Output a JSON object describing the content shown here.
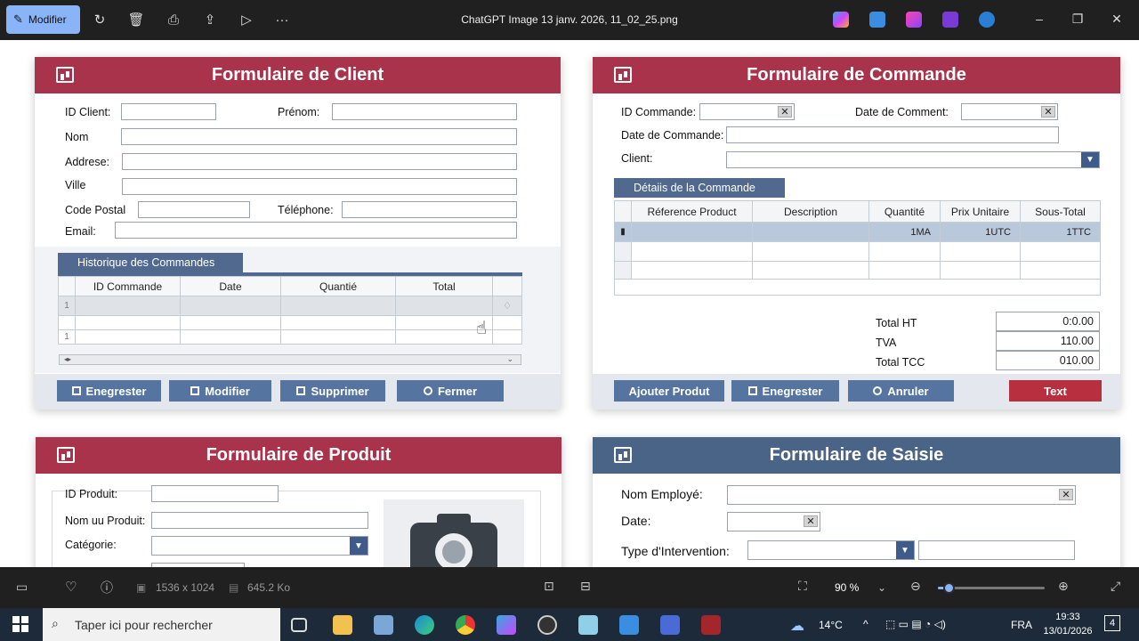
{
  "topbar": {
    "edit_label": "Modifier",
    "title": "ChatGPT Image 13 janv. 2026, 11_02_25.png"
  },
  "client_form": {
    "title": "Formulaire de Client",
    "labels": {
      "id": "ID Client:",
      "prenom": "Prénom:",
      "nom": "Nom",
      "adresse": "Addrese:",
      "ville": "Ville",
      "cp": "Code Postal",
      "tel": "Téléphone:",
      "email": "Email:"
    },
    "history_title": "Historique des Commandes",
    "history_cols": [
      "ID Commande",
      "Date",
      "Quantié",
      "Total"
    ],
    "row_num_1": "1",
    "row_num_3": "1",
    "buttons": [
      "Enegrester",
      "Modifier",
      "Supprimer",
      "Fermer"
    ]
  },
  "order_form": {
    "title": "Formulaire de Commande",
    "labels": {
      "id": "ID Commande:",
      "date_comment": "Date de Comment:",
      "date": "Date de Commande:",
      "client": "Client:"
    },
    "details_title": "Détaiis de la Commande",
    "cols": [
      "Réference Product",
      "Description",
      "Quantité",
      "Prix Unitaire",
      "Sous-Total"
    ],
    "row1": {
      "qty": "1MA",
      "unit": "1UTC",
      "sub": "1TTC"
    },
    "totals": [
      {
        "label": "Total HT",
        "value": "0:0.00"
      },
      {
        "label": "TVA",
        "value": "110.00"
      },
      {
        "label": "Total TCC",
        "value": "010.00"
      }
    ],
    "buttons": [
      "Ajouter Produt",
      "Enegrester",
      "Anruler",
      "Text"
    ]
  },
  "product_form": {
    "title": "Formulaire de Produit",
    "labels": {
      "id": "ID Produit:",
      "nom": "Nom uu Produit:",
      "cat": "Catégorie:"
    }
  },
  "entry_form": {
    "title": "Formulaire de Saisie",
    "labels": {
      "nom": "Nom Employé:",
      "date": "Date:",
      "type": "Type d'Intervention:"
    }
  },
  "viewbar": {
    "dimensions": "1536 x 1024",
    "size": "645.2 Ko",
    "zoom": "90 %",
    "zoom_level": 0.1
  },
  "taskbar": {
    "search_placeholder": "Taper ici pour rechercher",
    "weather": "14°C",
    "lang": "FRA",
    "time": "19:33",
    "date": "13/01/2026",
    "notif": "4"
  },
  "colors": {
    "red_header": "#a8334a",
    "blue_header": "#4a6487",
    "button_blue": "#5674a0",
    "accent": "#8ab4f8"
  }
}
